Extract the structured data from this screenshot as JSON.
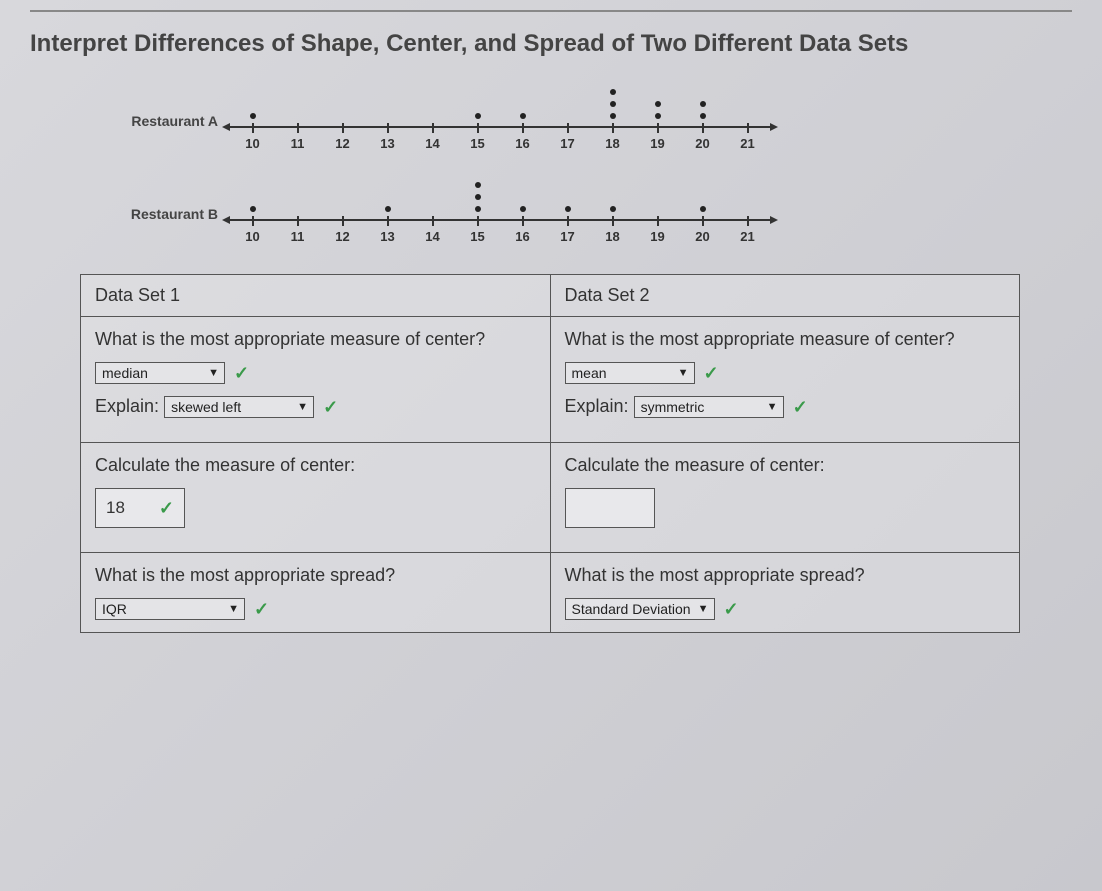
{
  "title": "Interpret Differences of Shape, Center, and Spread of Two Different Data Sets",
  "chart_data": [
    {
      "type": "dotplot",
      "label": "Restaurant A",
      "x": [
        10,
        11,
        12,
        13,
        14,
        15,
        16,
        17,
        18,
        19,
        20,
        21
      ],
      "counts": [
        1,
        0,
        0,
        0,
        0,
        1,
        1,
        0,
        3,
        2,
        2,
        0
      ]
    },
    {
      "type": "dotplot",
      "label": "Restaurant B",
      "x": [
        10,
        11,
        12,
        13,
        14,
        15,
        16,
        17,
        18,
        19,
        20,
        21
      ],
      "counts": [
        1,
        0,
        0,
        1,
        0,
        3,
        1,
        1,
        1,
        0,
        1,
        0
      ]
    }
  ],
  "table": {
    "col1": {
      "header": "Data Set 1",
      "q_center": "What is the most appropriate measure of center?",
      "center_select": "median",
      "explain_label": "Explain:",
      "explain_select": "skewed left",
      "q_calc": "Calculate the measure of center:",
      "calc_value": "18",
      "q_spread": "What is the most appropriate spread?",
      "spread_select": "IQR"
    },
    "col2": {
      "header": "Data Set 2",
      "q_center": "What is the most appropriate measure of center?",
      "center_select": "mean",
      "explain_label": "Explain:",
      "explain_select": "symmetric",
      "q_calc": "Calculate the measure of center:",
      "calc_value": "",
      "q_spread": "What is the most appropriate spread?",
      "spread_select": "Standard Deviation"
    }
  }
}
